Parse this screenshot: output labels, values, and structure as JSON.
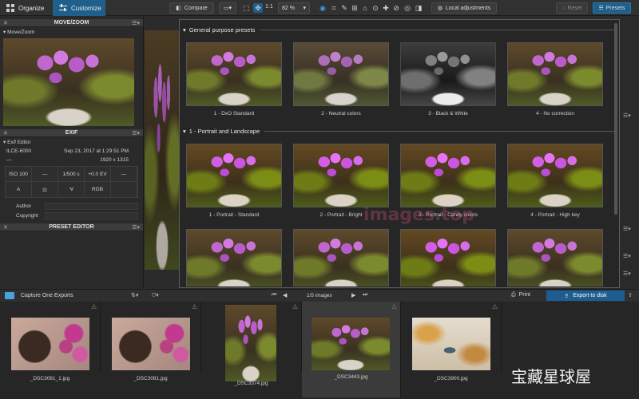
{
  "topbar": {
    "tabs": [
      "Organize",
      "Customize"
    ],
    "compare": "Compare",
    "zoom_ratio": "1:1",
    "zoom_value": "82 %",
    "local_adjustments": "Local adjustments",
    "reset": "Reset",
    "presets": "Presets"
  },
  "left": {
    "move_zoom_title": "MOVE/ZOOM",
    "move_zoom_sub": "Move/Zoom",
    "exif_title": "EXIF",
    "exif_sub": "Exif Editor",
    "camera": "ILCE-6000",
    "date": "Sep 23, 2017 at 1:29:51 PM",
    "dash": "—",
    "dimensions": "1920 x 1315",
    "exif_row1": [
      "ISO 100",
      "—",
      "1/500 s",
      "+0.0 EV",
      "—"
    ],
    "exif_row2": [
      "A",
      "",
      "",
      "RGB",
      ""
    ],
    "author_label": "Author",
    "copyright_label": "Copyright",
    "preset_editor_title": "PRESET EDITOR"
  },
  "presets": {
    "section1": "General purpose presets",
    "general": [
      "1 - DxO Standard",
      "2 - Neutral colors",
      "3 - Black & White",
      "4 - No correction"
    ],
    "section2": "1 - Portrait and Landscape",
    "portrait": [
      "1 - Portrait - Standard",
      "2 - Portrait - Bright",
      "3 - Portrait - Candy colors",
      "4 - Portrait - High key"
    ]
  },
  "browser": {
    "folder": "Capture One Exports",
    "count": "1/5 images",
    "print": "Print",
    "export": "Export to disk",
    "thumbs": [
      "_DSC3081_1.jpg",
      "_DSC3081.jpg",
      "_DSC3374.jpg",
      "_DSC3443.jpg",
      "_DSC3900.jpg"
    ]
  },
  "watermark": {
    "cn": "宝藏星球屋",
    "site": "images.top"
  },
  "colors": {
    "accent": "#1e5f8c",
    "export_button": "#1d5d92"
  }
}
